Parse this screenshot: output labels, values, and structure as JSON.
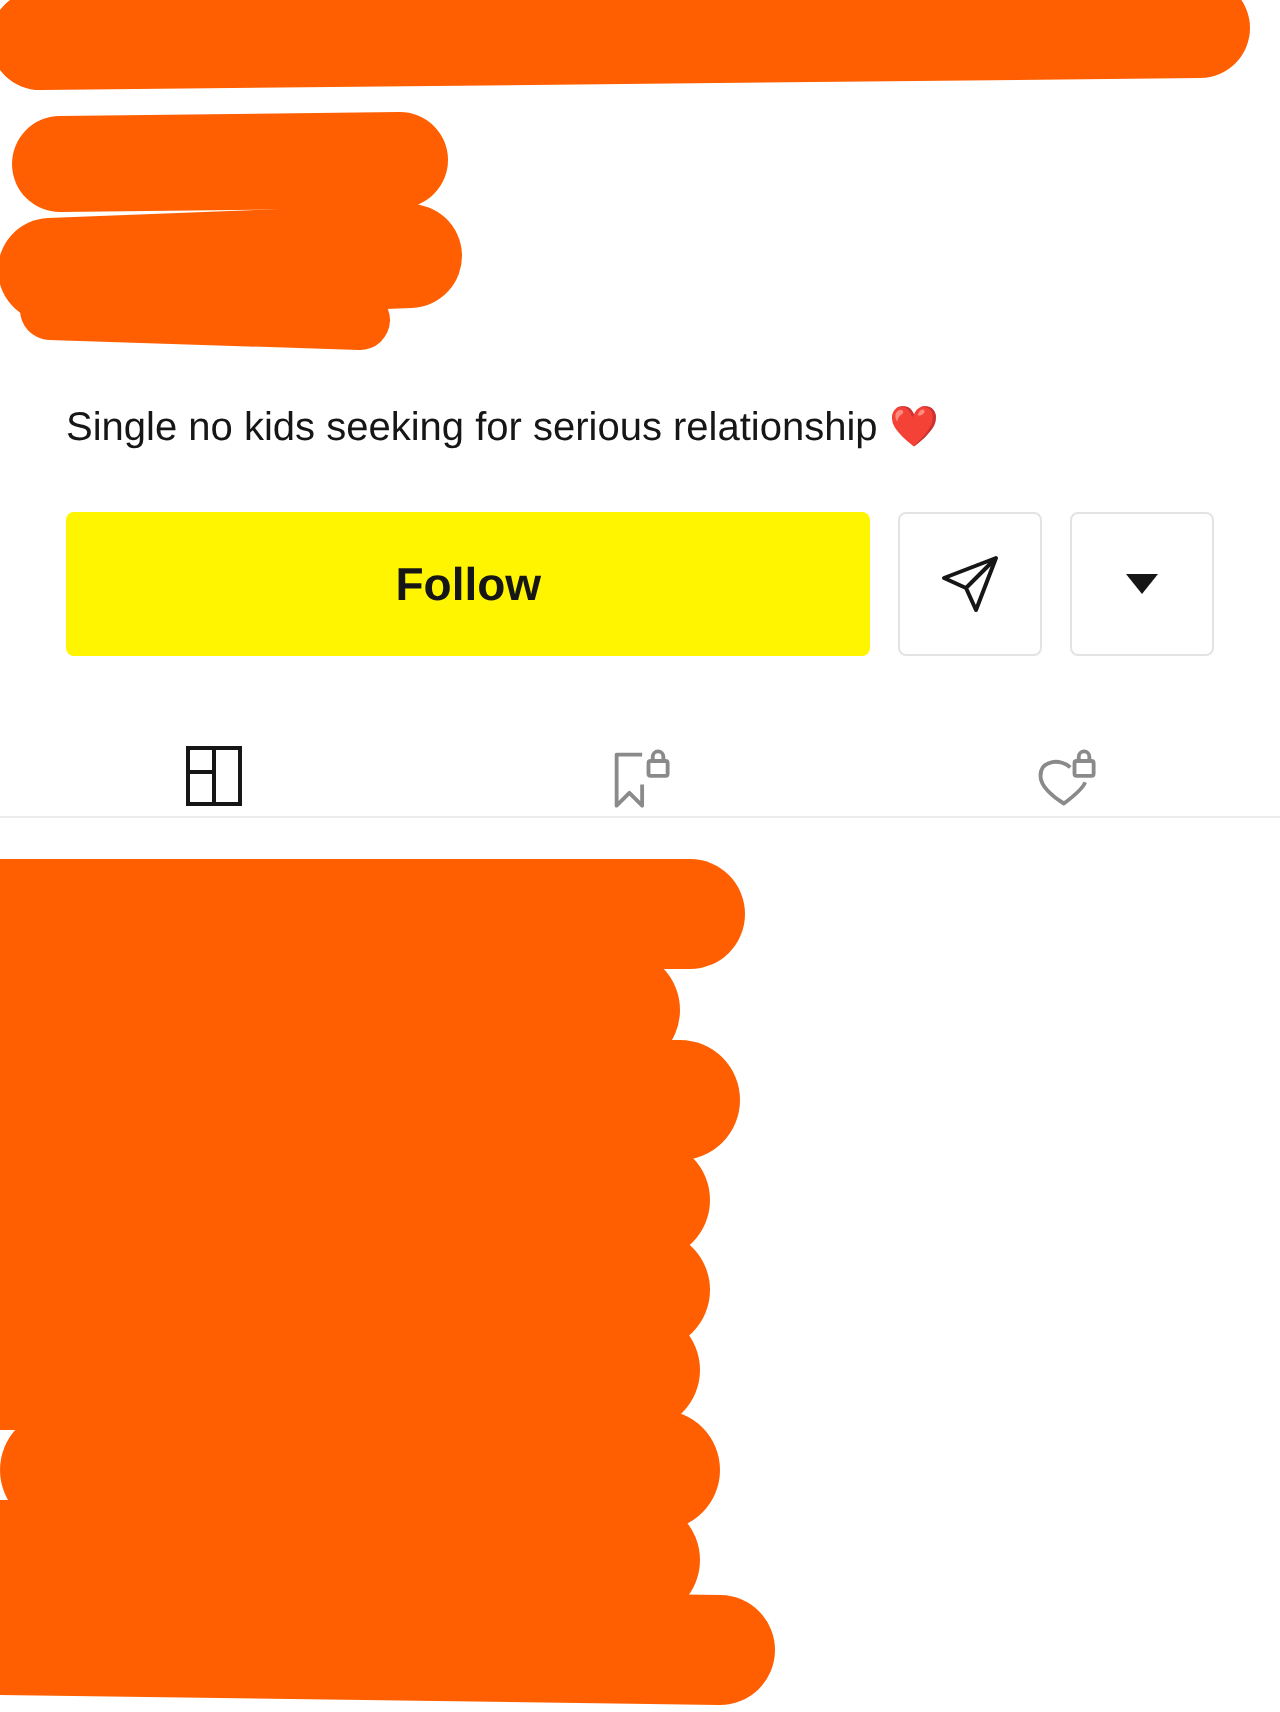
{
  "profile": {
    "bio": "Single no kids seeking for serious relationship ❤️"
  },
  "actions": {
    "follow_label": "Follow"
  },
  "tabs": [
    {
      "kind": "grid",
      "selected": true
    },
    {
      "kind": "saved",
      "selected": false
    },
    {
      "kind": "liked",
      "selected": false
    }
  ]
}
